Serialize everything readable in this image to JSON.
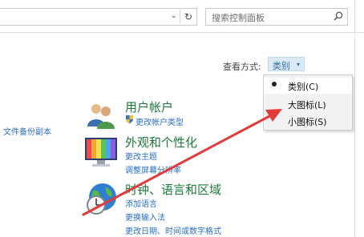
{
  "toolbar": {
    "search_placeholder": "搜索控制面板",
    "refresh_glyph": "↻",
    "dropdown_glyph": "⌄"
  },
  "view": {
    "label": "查看方式:",
    "current": "类别",
    "caret": "▾"
  },
  "menu": {
    "items": [
      {
        "label": "类别(C)",
        "selected": true
      },
      {
        "label": "大图标(L)",
        "selected": false
      },
      {
        "label": "小图标(S)",
        "selected": false
      }
    ]
  },
  "left_task": "文件备份副本",
  "categories": [
    {
      "icon": "users-icon",
      "title": "用户帐户",
      "links": [
        "更改帐户类型"
      ]
    },
    {
      "icon": "display-icon",
      "title": "外观和个性化",
      "links": [
        "更改主题",
        "调整屏幕分辨率"
      ]
    },
    {
      "icon": "clock-globe-icon",
      "title": "时钟、语言和区域",
      "links": [
        "添加语言",
        "更换输入法",
        "更改日期、时间或数字格式"
      ]
    }
  ],
  "colors": {
    "arrow": "#e23b3b",
    "category_title": "#1b7a3a",
    "link": "#2a6fc9",
    "view_button_bg": "#dbe9f7"
  }
}
